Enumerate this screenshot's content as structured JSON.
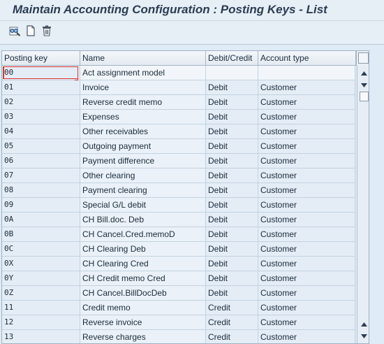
{
  "title": "Maintain Accounting Configuration : Posting Keys - List",
  "toolbar": {
    "buttons": [
      {
        "name": "display-change-button",
        "icon": "glasses-pencil-icon"
      },
      {
        "name": "new-entries-button",
        "icon": "blank-document-icon"
      },
      {
        "name": "delete-button",
        "icon": "trash-icon"
      }
    ]
  },
  "table": {
    "columns": [
      "Posting key",
      "Name",
      "Debit/Credit",
      "Account type"
    ],
    "rows": [
      {
        "key": "00",
        "name": "Act assignment model",
        "dc": "",
        "acct": ""
      },
      {
        "key": "01",
        "name": "Invoice",
        "dc": "Debit",
        "acct": "Customer"
      },
      {
        "key": "02",
        "name": "Reverse credit memo",
        "dc": "Debit",
        "acct": "Customer"
      },
      {
        "key": "03",
        "name": "Expenses",
        "dc": "Debit",
        "acct": "Customer"
      },
      {
        "key": "04",
        "name": "Other receivables",
        "dc": "Debit",
        "acct": "Customer"
      },
      {
        "key": "05",
        "name": "Outgoing payment",
        "dc": "Debit",
        "acct": "Customer"
      },
      {
        "key": "06",
        "name": "Payment difference",
        "dc": "Debit",
        "acct": "Customer"
      },
      {
        "key": "07",
        "name": "Other clearing",
        "dc": "Debit",
        "acct": "Customer"
      },
      {
        "key": "08",
        "name": "Payment clearing",
        "dc": "Debit",
        "acct": "Customer"
      },
      {
        "key": "09",
        "name": "Special G/L debit",
        "dc": "Debit",
        "acct": "Customer"
      },
      {
        "key": "0A",
        "name": "CH Bill.doc. Deb",
        "dc": "Debit",
        "acct": "Customer"
      },
      {
        "key": "0B",
        "name": "CH Cancel.Cred.memoD",
        "dc": "Debit",
        "acct": "Customer"
      },
      {
        "key": "0C",
        "name": "CH Clearing Deb",
        "dc": "Debit",
        "acct": "Customer"
      },
      {
        "key": "0X",
        "name": "CH Clearing Cred",
        "dc": "Debit",
        "acct": "Customer"
      },
      {
        "key": "0Y",
        "name": "CH Credit memo Cred",
        "dc": "Debit",
        "acct": "Customer"
      },
      {
        "key": "0Z",
        "name": "CH Cancel.BillDocDeb",
        "dc": "Debit",
        "acct": "Customer"
      },
      {
        "key": "11",
        "name": "Credit memo",
        "dc": "Credit",
        "acct": "Customer"
      },
      {
        "key": "12",
        "name": "Reverse invoice",
        "dc": "Credit",
        "acct": "Customer"
      },
      {
        "key": "13",
        "name": "Reverse charges",
        "dc": "Credit",
        "acct": "Customer"
      }
    ]
  },
  "colors": {
    "title_text": "#2b3d52",
    "grid_background": "#dde9f3",
    "focus_marker": "#dd3333"
  }
}
